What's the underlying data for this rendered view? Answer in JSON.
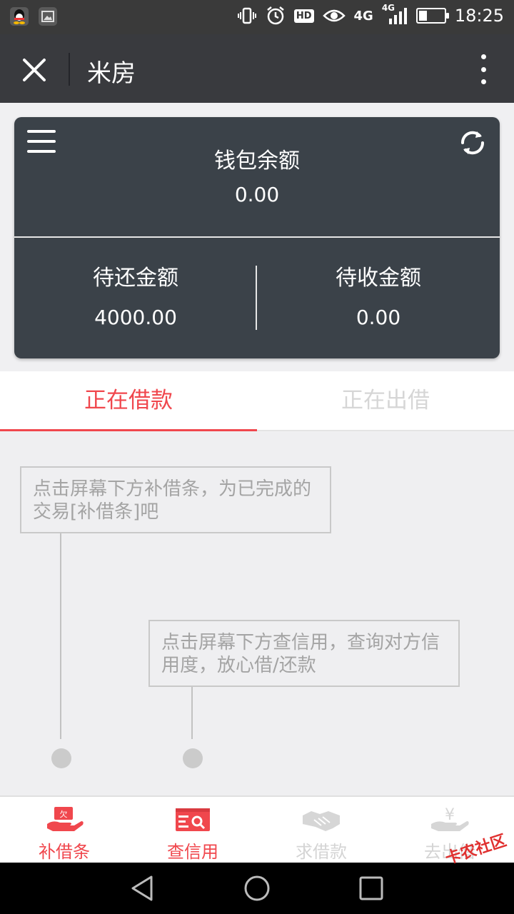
{
  "status_bar": {
    "hd_label": "HD",
    "net_label_1": "4G",
    "net_label_2": "4G",
    "time": "18:25",
    "battery_level": 0.3
  },
  "title_bar": {
    "title": "米房"
  },
  "wallet": {
    "title": "钱包余额",
    "balance": "0.00",
    "left_label": "待还金额",
    "left_value": "4000.00",
    "right_label": "待收金额",
    "right_value": "0.00"
  },
  "tabs": [
    {
      "label": "正在借款",
      "active": true
    },
    {
      "label": "正在出借",
      "active": false
    }
  ],
  "guide": {
    "tip1": "点击屏幕下方补借条，为已完成的交易[补借条]吧",
    "tip2": "点击屏幕下方查信用，查询对方信用度，放心借/还款"
  },
  "bottom_nav": [
    {
      "label": "补借条",
      "icon": "iou-hand-icon",
      "active": true
    },
    {
      "label": "查信用",
      "icon": "credit-search-icon",
      "active": true
    },
    {
      "label": "求借款",
      "icon": "handshake-icon",
      "active": false
    },
    {
      "label": "去出借",
      "icon": "yen-hand-icon",
      "active": false
    }
  ],
  "watermark": "卡农社区",
  "colors": {
    "accent": "#f0474d",
    "header": "#393a3e",
    "card": "#3b4249",
    "status_bar": "#3a3a3a"
  }
}
